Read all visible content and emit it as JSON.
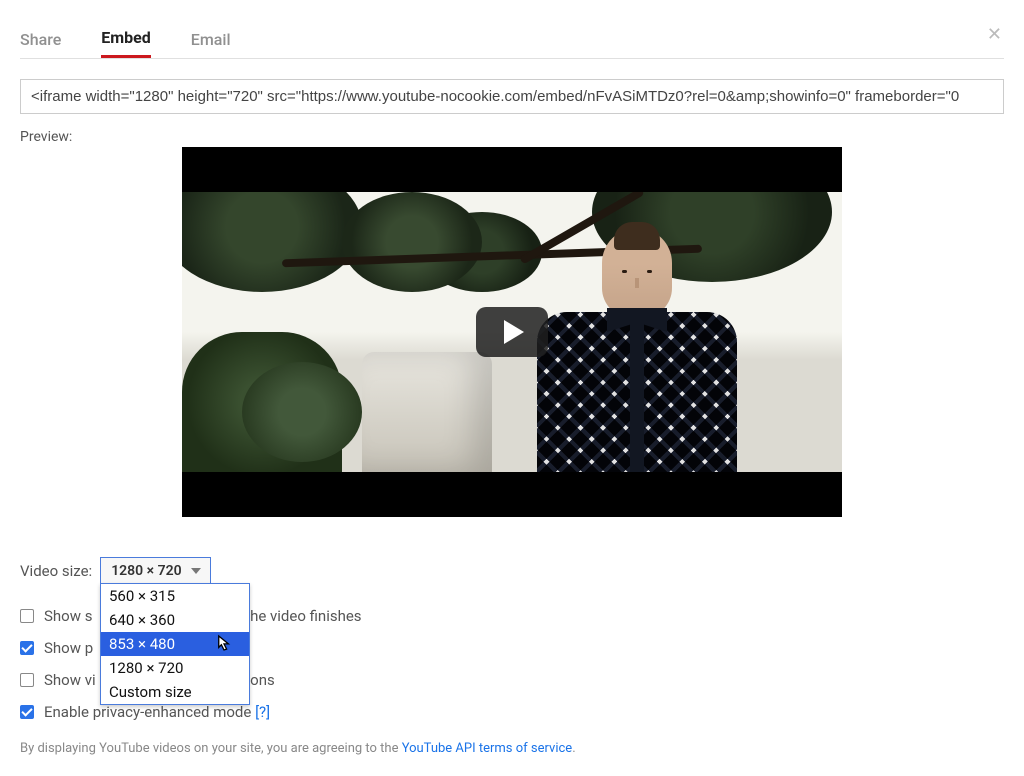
{
  "tabs": {
    "share": "Share",
    "embed": "Embed",
    "email": "Email"
  },
  "embedCode": "<iframe width=\"1280\" height=\"720\" src=\"https://www.youtube-nocookie.com/embed/nFvASiMTDz0?rel=0&amp;showinfo=0\" frameborder=\"0",
  "previewLabel": "Preview:",
  "videoSize": {
    "label": "Video size:",
    "selected": "1280 × 720",
    "options": [
      "560 × 315",
      "640 × 360",
      "853 × 480",
      "1280 × 720",
      "Custom size"
    ],
    "highlighted": "853 × 480"
  },
  "options": {
    "suggested": {
      "label_before": "Show s",
      "label_after": "hen the video finishes",
      "checked": false
    },
    "player": {
      "label_before": "Show p",
      "label_after": "",
      "checked": true
    },
    "title": {
      "label_before": "Show vi",
      "label_after": "r actions",
      "checked": false
    },
    "privacy": {
      "label": "Enable privacy-enhanced mode ",
      "help": "[?]",
      "checked": true
    }
  },
  "tos": {
    "prefix": "By displaying YouTube videos on your site, you are agreeing to the ",
    "link": "YouTube API terms of service",
    "suffix": "."
  }
}
